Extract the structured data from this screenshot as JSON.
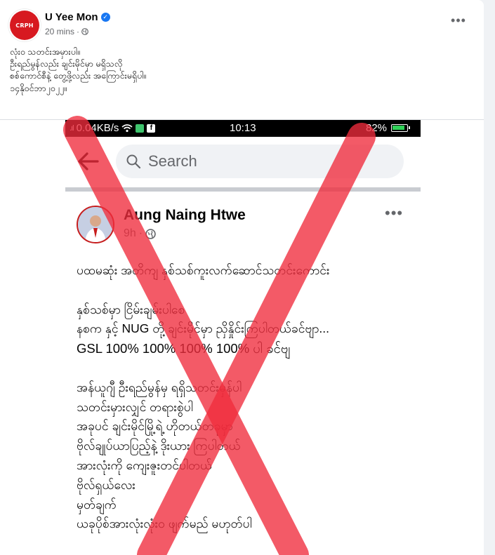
{
  "post": {
    "avatar_text": "CRPH",
    "author": "U Yee Mon",
    "time": "20 mins",
    "lines": [
      "လုံး၀ သတင်းအမှားပါ။",
      "ဦးရည်မွန်လည်း ချင်းမိုင်မှာ မရှိသလို",
      "စစ်ကောင်စီနဲ့ တွေ့ဖို့လည်း အကြောင်းမရှိပါ။",
      "၁၄နိုဝင်ဘာ၂၀၂၂။"
    ]
  },
  "screenshot": {
    "status": {
      "speed": "0.04KB/s",
      "time": "10:13",
      "battery": "82%"
    },
    "search_placeholder": "Search",
    "inner_post": {
      "author": "Aung Naing Htwe",
      "time": "9h",
      "lines": [
        "ပထမဆုံး အတိကျ နှစ်သစ်ကူးလက်ဆောင်သတင်းကောင်း",
        "",
        "နှစ်သစ်မှာ ငြိမ်းချမ်းပါစေ",
        "နစက နှင့် NUG တို့ ချင်းမိုင်မှာ ညှိနှိုင်းကြပါတယ်ခင်ဗျာ...",
        "GSL 100%   100%  100%  100% ပါ ခင်ဗျ",
        "",
        "အန်ယူဂျီ ဦးရည်မွန်မှ ရရှိသတင်းမှန်ပါ",
        "သတင်းမှားလျှင် တရားစွဲပါ",
        "အခုပင် ချင်းမိုင်မြို့ရဲ့ ဟိုတယ်တခုမှာ",
        "ဗိုလ်ချုပ်ယာပြည့်နဲ့ ဒိုးယား ကြပါတယ်",
        "အားလုံးကို ကျေးဇူးတင်ပါတယ်",
        "ဗိုလ်ရှယ်လေး",
        "မှတ်ချက်",
        "ယခုပိုစ်အားလုံးလုံး၀ ဖျက်မည် မဟုတ်ပါ"
      ]
    }
  },
  "colors": {
    "cross": "#ef2b3c",
    "verified": "#1877f2",
    "brand": "#d71920"
  }
}
